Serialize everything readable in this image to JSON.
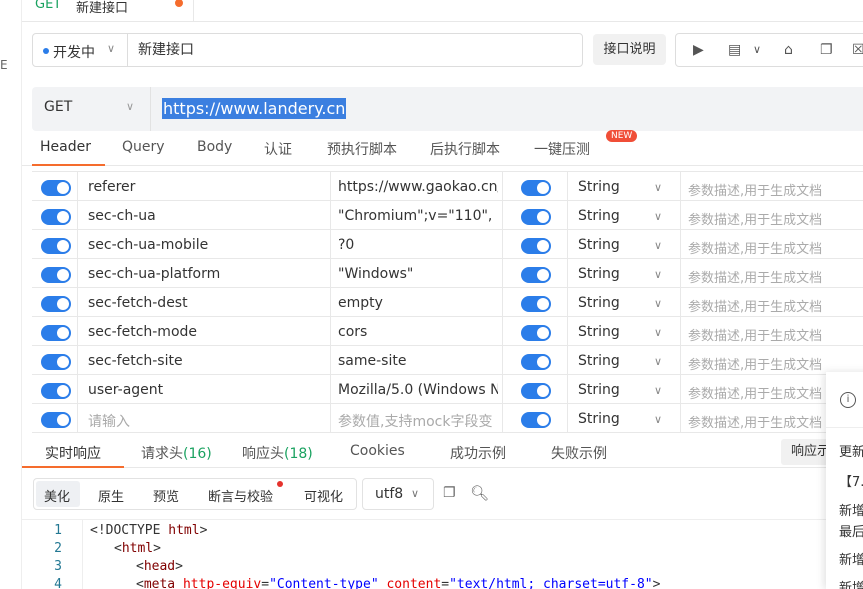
{
  "doc_tab": {
    "method": "GET",
    "name": "新建接口"
  },
  "status": {
    "label": "开发中"
  },
  "name_input": {
    "value": "新建接口"
  },
  "doc_button": "接口说明",
  "url_bar": {
    "method": "GET",
    "url": "https://www.landery.cn"
  },
  "request_tabs": [
    {
      "label": "Header",
      "active": true
    },
    {
      "label": "Query"
    },
    {
      "label": "Body"
    },
    {
      "label": "认证"
    },
    {
      "label": "预执行脚本"
    },
    {
      "label": "后执行脚本"
    },
    {
      "label": "一键压测",
      "badge": "NEW"
    }
  ],
  "headers": {
    "rows": [
      {
        "key": "referer",
        "value": "https://www.gaokao.cn/",
        "type": "String",
        "desc": "参数描述,用于生成文档"
      },
      {
        "key": "sec-ch-ua",
        "value": "\"Chromium\";v=\"110\",",
        "type": "String",
        "desc": "参数描述,用于生成文档"
      },
      {
        "key": "sec-ch-ua-mobile",
        "value": "?0",
        "type": "String",
        "desc": "参数描述,用于生成文档"
      },
      {
        "key": "sec-ch-ua-platform",
        "value": "\"Windows\"",
        "type": "String",
        "desc": "参数描述,用于生成文档"
      },
      {
        "key": "sec-fetch-dest",
        "value": "empty",
        "type": "String",
        "desc": "参数描述,用于生成文档"
      },
      {
        "key": "sec-fetch-mode",
        "value": "cors",
        "type": "String",
        "desc": "参数描述,用于生成文档"
      },
      {
        "key": "sec-fetch-site",
        "value": "same-site",
        "type": "String",
        "desc": "参数描述,用于生成文档"
      },
      {
        "key": "user-agent",
        "value": "Mozilla/5.0 (Windows N",
        "type": "String",
        "desc": "参数描述,用于生成文档"
      }
    ],
    "new_row": {
      "key_placeholder": "请输入",
      "value_placeholder": "参数值,支持mock字段变",
      "type": "String",
      "desc": "参数描述,用于生成文档"
    }
  },
  "response_tabs": {
    "realtime": "实时响应",
    "req_headers": "请求头",
    "req_headers_count": "(16)",
    "resp_headers": "响应头",
    "resp_headers_count": "(18)",
    "cookies": "Cookies",
    "success": "成功示例",
    "fail": "失败示例",
    "right_btn": "响应示"
  },
  "view_modes": [
    "美化",
    "原生",
    "预览",
    "断言与校验",
    "可视化"
  ],
  "encoding": "utf8",
  "code": {
    "line_numbers": [
      "1",
      "2",
      "3",
      "4"
    ],
    "l1_open": "<!DOCTYPE ",
    "l1_tag": "html",
    "l1_close": ">",
    "l2_open": "<",
    "l2_tag": "html",
    "l2_close": ">",
    "l3_open": "<",
    "l3_tag": "head",
    "l3_close": ">",
    "l4_open": "<",
    "l4_tag": "meta ",
    "l4_attr1": "http-equiv",
    "l4_eq1": "=",
    "l4_val1": "\"Content-type\"",
    "l4_attr2": " content",
    "l4_eq2": "=",
    "l4_val2": "\"text/html; charset=utf-8\"",
    "l4_close": ">"
  },
  "notice": {
    "icon": "info-icon",
    "lines": [
      "更新",
      "【7.",
      "新增",
      "最后",
      "新增",
      "新增"
    ]
  },
  "rail_glyph": "E",
  "colors": {
    "accent": "#f56c2d",
    "toggle": "#2b7de9",
    "green": "#1aa260",
    "badge": "#f04e37"
  }
}
